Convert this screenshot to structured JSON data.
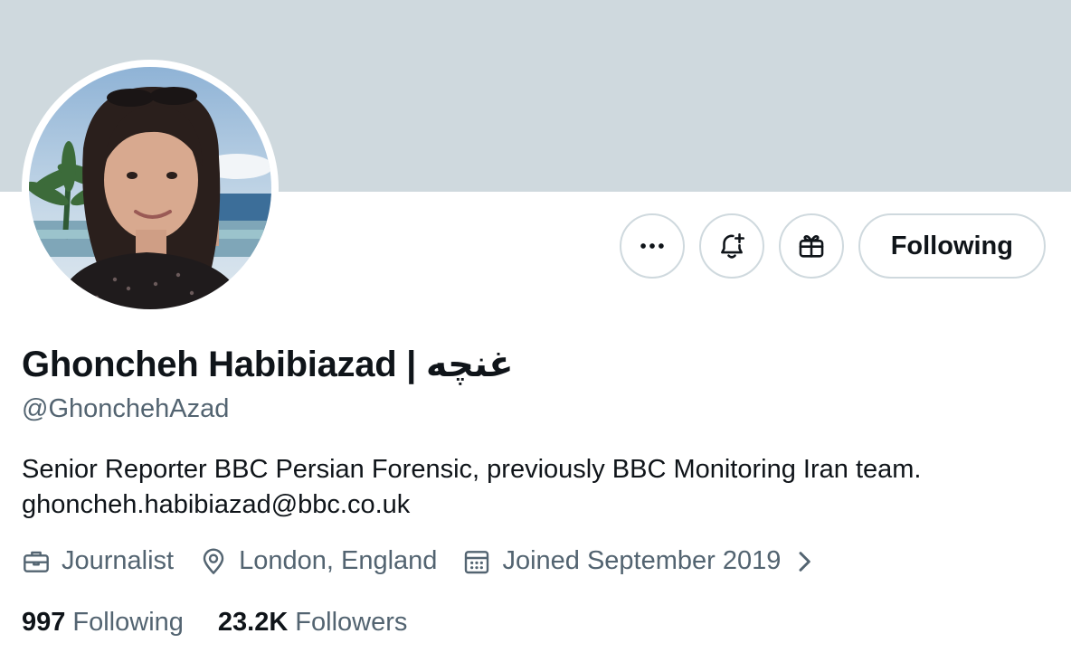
{
  "profile": {
    "name": "Ghoncheh Habibiazad | غنچه",
    "handle": "@GhonchehAzad",
    "bio_line1": "Senior Reporter BBC Persian Forensic, previously BBC Monitoring Iran team.",
    "bio_line2": "ghoncheh.habibiazad@bbc.co.uk",
    "profession": "Journalist",
    "location": "London, England",
    "joined": "Joined September 2019"
  },
  "actions": {
    "more_icon": "more-horizontal-icon",
    "notify_icon": "bell-plus-icon",
    "gift_icon": "gift-icon",
    "following_label": "Following"
  },
  "stats": {
    "following_count": "997",
    "following_label": "Following",
    "followers_count": "23.2K",
    "followers_label": "Followers"
  },
  "colors": {
    "banner": "#cfd9de",
    "primary_text": "#0f1419",
    "secondary_text": "#536471",
    "border": "#cfd9de"
  }
}
